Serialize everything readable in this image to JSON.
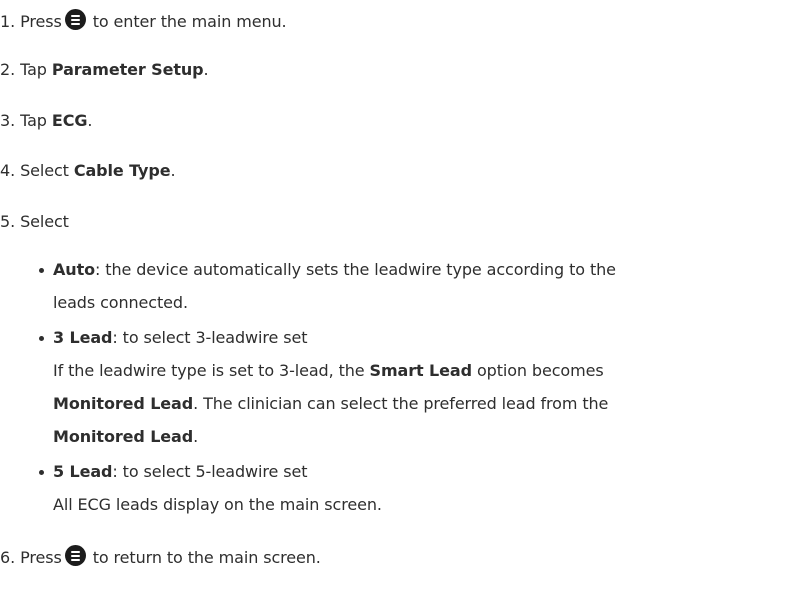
{
  "steps": {
    "s1": {
      "num": "1.",
      "pre": "Press",
      "post": "to enter the main menu.",
      "icon": "menu-button-icon"
    },
    "s2": {
      "num": "2.",
      "pre": "Tap",
      "bold": "Parameter Setup",
      "post": "."
    },
    "s3": {
      "num": "3.",
      "pre": "Tap",
      "bold": "ECG",
      "post": "."
    },
    "s4": {
      "num": "4.",
      "pre": "Select",
      "bold": "Cable Type",
      "post": "."
    },
    "s5": {
      "num": "5.",
      "text": "Select"
    },
    "s6": {
      "num": "6.",
      "pre": "Press",
      "post": "to return to the main screen.",
      "icon": "menu-button-icon"
    }
  },
  "options": {
    "auto": {
      "bold": "Auto",
      "line1": ": the device automatically sets the leadwire type according to the",
      "line2": "leads connected."
    },
    "lead3": {
      "bold": "3 Lead",
      "rest": ": to select 3-leadwire set",
      "l2_pre": "If the leadwire type is set to 3-lead, the",
      "l2_bold": "Smart Lead",
      "l2_post": "option becomes",
      "l3_bold": "Monitored Lead",
      "l3_post": ". The clinician can select the preferred lead from the",
      "l4_bold": "Monitored Lead",
      "l4_post": "."
    },
    "lead5": {
      "bold": "5 Lead",
      "rest": ": to select 5-leadwire set",
      "line2": "All ECG leads display on the main screen."
    }
  }
}
